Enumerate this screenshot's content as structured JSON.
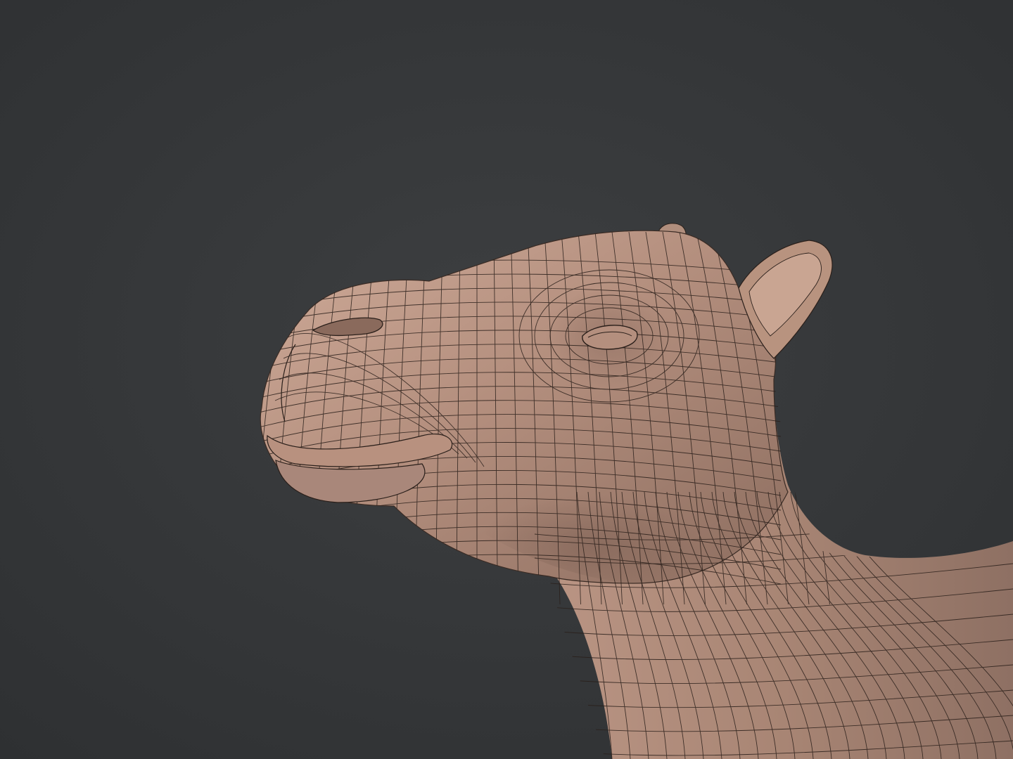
{
  "scene": {
    "subject": "camel-head-mesh",
    "colors": {
      "background": "#37393b",
      "background_vignette": "#2c2e30",
      "surface_light": "#c9a493",
      "surface_mid": "#a98676",
      "surface_dark": "#7a5e52",
      "wire": "#2a1f1a"
    }
  }
}
